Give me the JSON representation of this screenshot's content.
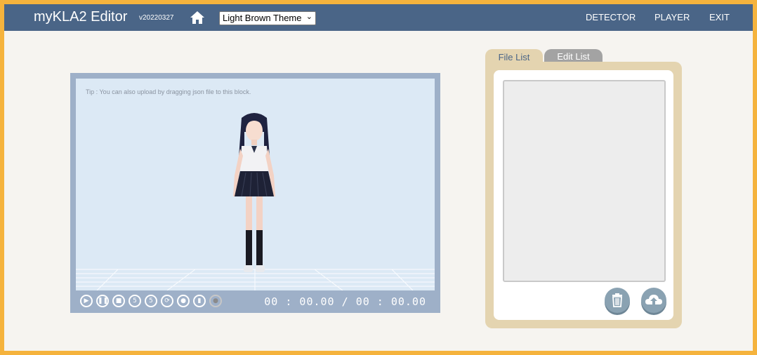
{
  "header": {
    "title": "myKLA2 Editor",
    "version": "v20220327",
    "theme_select": "Light Brown Theme",
    "nav": [
      "DETECTOR",
      "PLAYER",
      "EXIT"
    ]
  },
  "viewer": {
    "tip": "Tip : You can also upload by dragging json file to this block.",
    "time_current": "00 : 00.00",
    "time_separator": "/",
    "time_total": "00 : 00.00",
    "controls": [
      "play-icon",
      "pause-icon",
      "stop-icon",
      "rewind-5-icon",
      "forward-5-icon",
      "loop-icon",
      "microphone-icon",
      "bookmark-icon",
      "record-icon"
    ]
  },
  "panel": {
    "tabs": [
      "File List",
      "Edit List"
    ]
  },
  "colors": {
    "border": "#f5b33d",
    "topbar": "#4a6587",
    "panel": "#e4d4b0",
    "viewer_frame": "#9eb0c8"
  }
}
